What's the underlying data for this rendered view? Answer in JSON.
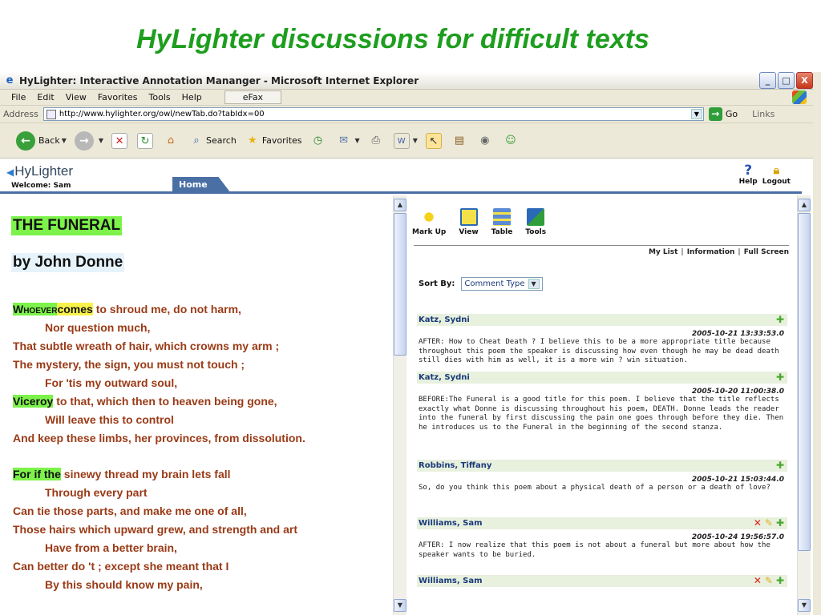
{
  "slide": {
    "title": "HyLighter discussions for difficult texts"
  },
  "window": {
    "title": "HyLighter: Interactive Annotation Mananger - Microsoft Internet Explorer",
    "buttons": [
      "_",
      "□",
      "X"
    ]
  },
  "menubar": {
    "items": [
      "File",
      "Edit",
      "View",
      "Favorites",
      "Tools",
      "Help"
    ],
    "efax": "eFax"
  },
  "addressbar": {
    "label": "Address",
    "url": "http://www.hylighter.org/owl/newTab.do?tabIdx=00",
    "go": "Go",
    "links": "Links"
  },
  "toolbar": {
    "back": "Back",
    "search": "Search",
    "favorites": "Favorites"
  },
  "app": {
    "logo": "HyLighter",
    "welcome": "Welcome: Sam",
    "home_tab": "Home",
    "help": "Help",
    "logout": "Logout"
  },
  "poem": {
    "title": "THE FUNERAL",
    "author": "by John Donne",
    "lines": [
      "Whoever",
      "comes",
      " to shroud me, do not harm,",
      "Nor question much,",
      "That subtle wreath of hair, which crowns my arm ;",
      "The mystery, the sign, you must not touch ;",
      "For 'tis my outward soul,",
      "Viceroy",
      " to that, which then to heaven being gone,",
      "Will leave this to control",
      "And keep these limbs, her provinces, from dissolution.",
      "For if the",
      " sinewy thread my brain lets fall",
      "Through every part",
      "Can tie those parts, and make me one of all,",
      "Those hairs which upward grew, and strength and art",
      "Have from a better brain,",
      "Can better do 't ; except she meant that I",
      "By this should know my pain,"
    ]
  },
  "panel": {
    "tools": [
      "Mark Up",
      "View",
      "Table",
      "Tools"
    ],
    "links": [
      "My List",
      "Information",
      "Full Screen"
    ],
    "sort_label": "Sort By:",
    "sort_value": "Comment Type",
    "comments": [
      {
        "author": "Katz, Sydni",
        "date": "2005-10-21 13:33:53.0",
        "text": "AFTER: How to Cheat Death ? I believe this to be a more appropriate title because throughout this poem the speaker is discussing how even though he may be dead death still dies with him as well, it is a more win ? win situation."
      },
      {
        "author": "Katz, Sydni",
        "date": "2005-10-20 11:00:38.0",
        "text": "BEFORE:The Funeral is a good title for this poem. I believe that the title reflects exactly what Donne is discussing throughout his poem, DEATH. Donne leads the reader into the funeral by first discussing the pain one goes through before they die. Then he introduces us to the Funeral in the beginning of the second stanza."
      },
      {
        "author": "Robbins, Tiffany",
        "date": "2005-10-21 15:03:44.0",
        "text": "So, do you think this poem about a physical death of a person or a death of love?"
      },
      {
        "author": "Williams, Sam",
        "date": "2005-10-24 19:56:57.0",
        "text": "AFTER: I now realize that this poem is not about a funeral but more about how the speaker wants to be buried."
      },
      {
        "author": "Williams, Sam",
        "date": "",
        "text": ""
      }
    ]
  }
}
